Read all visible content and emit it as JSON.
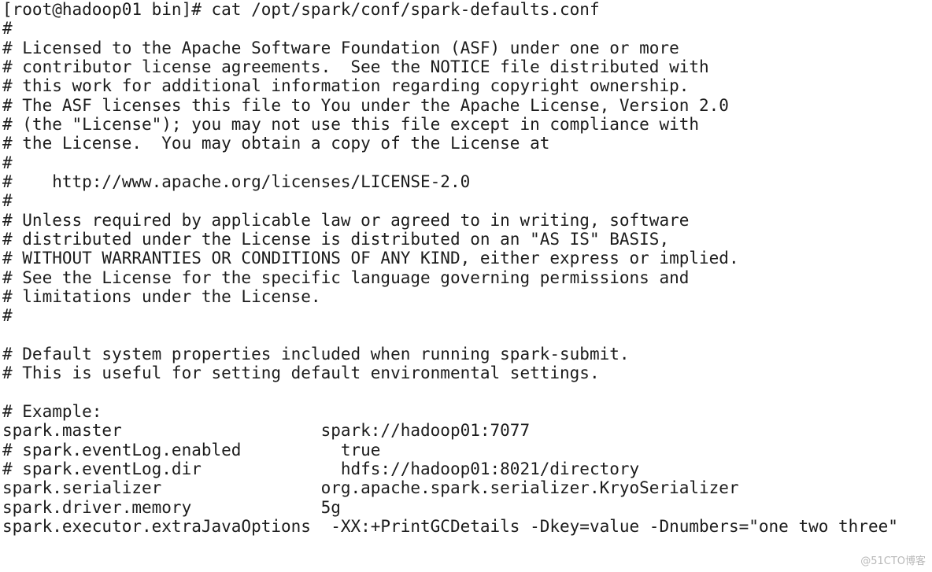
{
  "terminal": {
    "lines": [
      "[root@hadoop01 bin]# cat /opt/spark/conf/spark-defaults.conf",
      "#",
      "# Licensed to the Apache Software Foundation (ASF) under one or more",
      "# contributor license agreements.  See the NOTICE file distributed with",
      "# this work for additional information regarding copyright ownership.",
      "# The ASF licenses this file to You under the Apache License, Version 2.0",
      "# (the \"License\"); you may not use this file except in compliance with",
      "# the License.  You may obtain a copy of the License at",
      "#",
      "#    http://www.apache.org/licenses/LICENSE-2.0",
      "#",
      "# Unless required by applicable law or agreed to in writing, software",
      "# distributed under the License is distributed on an \"AS IS\" BASIS,",
      "# WITHOUT WARRANTIES OR CONDITIONS OF ANY KIND, either express or implied.",
      "# See the License for the specific language governing permissions and",
      "# limitations under the License.",
      "#",
      "",
      "# Default system properties included when running spark-submit.",
      "# This is useful for setting default environmental settings.",
      "",
      "# Example:",
      "spark.master                    spark://hadoop01:7077",
      "# spark.eventLog.enabled          true",
      "# spark.eventLog.dir              hdfs://hadoop01:8021/directory",
      "spark.serializer                org.apache.spark.serializer.KryoSerializer",
      "spark.driver.memory             5g",
      "spark.executor.extraJavaOptions  -XX:+PrintGCDetails -Dkey=value -Dnumbers=\"one two three\""
    ]
  },
  "watermark": "@51CTO博客"
}
